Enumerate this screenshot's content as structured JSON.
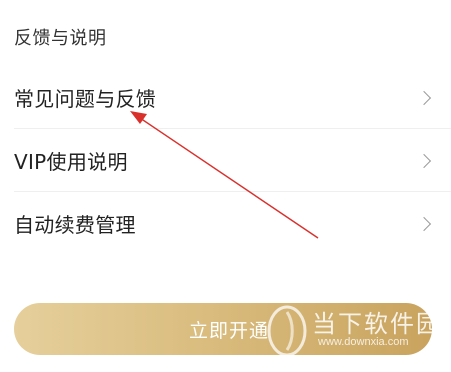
{
  "section": {
    "title": "反馈与说明"
  },
  "menu": {
    "items": [
      {
        "label": "常见问题与反馈",
        "icon": "chevron-right-icon"
      },
      {
        "label": "VIP使用说明",
        "icon": "chevron-right-icon"
      },
      {
        "label": "自动续费管理",
        "icon": "chevron-right-icon"
      }
    ]
  },
  "cta": {
    "label": "立即开通",
    "gradient_start": "#e6cf9c",
    "gradient_end": "#c9a35e"
  },
  "annotation": {
    "arrow_color": "#d9302c"
  },
  "watermark": {
    "name": "当下软件园",
    "url": "www.downxia.com"
  }
}
